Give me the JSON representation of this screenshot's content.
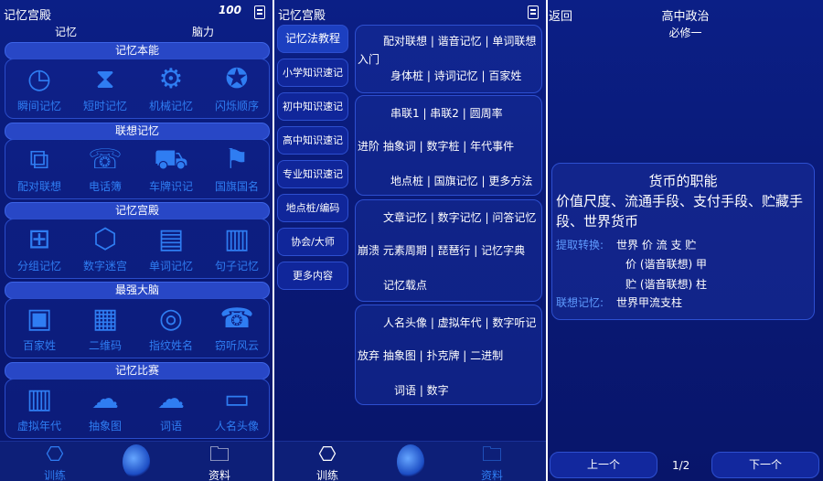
{
  "panel1": {
    "title": "记忆宫殿",
    "score": "100",
    "tabs": [
      "记忆",
      "脑力"
    ],
    "sections": [
      {
        "title": "记忆本能",
        "items": [
          {
            "label": "瞬间记忆",
            "icon": "clock-icon"
          },
          {
            "label": "短时记忆",
            "icon": "hourglass-icon"
          },
          {
            "label": "机械记忆",
            "icon": "gear-icon"
          },
          {
            "label": "闪烁顺序",
            "icon": "star-icon"
          }
        ]
      },
      {
        "title": "联想记忆",
        "items": [
          {
            "label": "配对联想",
            "icon": "pair-icon"
          },
          {
            "label": "电话簿",
            "icon": "phonebook-icon"
          },
          {
            "label": "车牌识记",
            "icon": "car-icon"
          },
          {
            "label": "国旗国名",
            "icon": "flag-icon"
          }
        ]
      },
      {
        "title": "记忆宫殿",
        "items": [
          {
            "label": "分组记忆",
            "icon": "org-chart-icon"
          },
          {
            "label": "数字迷宫",
            "icon": "cube-icon"
          },
          {
            "label": "单词记忆",
            "icon": "letters-icon"
          },
          {
            "label": "句子记忆",
            "icon": "document-icon"
          }
        ]
      },
      {
        "title": "最强大脑",
        "items": [
          {
            "label": "百家姓",
            "icon": "surname-icon"
          },
          {
            "label": "二维码",
            "icon": "qrcode-icon"
          },
          {
            "label": "指纹姓名",
            "icon": "fingerprint-icon"
          },
          {
            "label": "窃听风云",
            "icon": "phone-icon"
          }
        ]
      },
      {
        "title": "记忆比赛",
        "items": [
          {
            "label": "虚拟年代",
            "icon": "barcode-icon"
          },
          {
            "label": "抽象图",
            "icon": "abstract-icon"
          },
          {
            "label": "词语",
            "icon": "cloud-word-icon"
          },
          {
            "label": "人名头像",
            "icon": "idcard-icon"
          }
        ]
      }
    ],
    "nav": {
      "train": "训练",
      "material": "资料"
    }
  },
  "panel2": {
    "title": "记忆宫殿",
    "side": [
      "记忆法教程",
      "小学知识速记",
      "初中知识速记",
      "高中知识速记",
      "专业知识速记",
      "地点桩/编码",
      "协会/大师",
      "更多内容"
    ],
    "cards": [
      {
        "rows": [
          "配对联想 | 谐音记忆 | 单词联想",
          "入门",
          "身体桩 | 诗词记忆 | 百家姓"
        ]
      },
      {
        "rows": [
          "串联1 | 串联2 | 圆周率",
          "进阶  抽象词 | 数字桩 | 年代事件",
          "地点桩 | 国旗记忆 | 更多方法"
        ]
      },
      {
        "rows": [
          "文章记忆 | 数字记忆 | 问答记忆",
          "崩溃  元素周期 | 琵琶行 | 记忆字典",
          "记忆载点"
        ]
      },
      {
        "rows": [
          "人名头像 | 虚拟年代 | 数字听记",
          "放弃  抽象图 | 扑克牌 | 二进制",
          "词语 | 数字"
        ]
      }
    ],
    "nav": {
      "train": "训练",
      "material": "资料"
    }
  },
  "panel3": {
    "back": "返回",
    "title": "高中政治",
    "subtitle": "必修一",
    "card": {
      "title": "货币的职能",
      "text": "价值尺度、流通手段、支付手段、贮藏手段、世界货币",
      "extract_label": "提取转换:",
      "extract_value": "世界 价 流 支 贮",
      "line2": "价 (谐音联想) 甲",
      "line3": "贮 (谐音联想) 柱",
      "assoc_label": "联想记忆:",
      "assoc_value": "世界甲流支柱"
    },
    "prev": "上一个",
    "next": "下一个",
    "pager": "1/2"
  },
  "colors": {
    "bg": "#0a1a78",
    "accent": "#2f7df2",
    "highlight": "#5f9bff"
  }
}
